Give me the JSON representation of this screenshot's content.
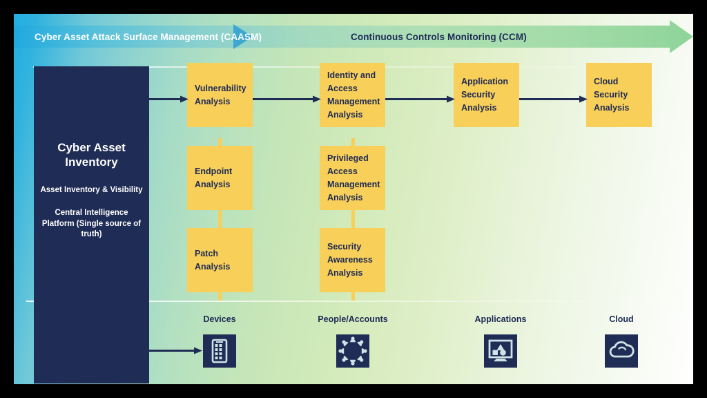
{
  "diagram": {
    "title": "Cyber Asset Attack Surface Management and Continuous Controls Monitoring",
    "colors": {
      "dark_navy": "#1F2C55",
      "accent_yellow": "#F8CF59",
      "gradient_start": "#22AEE3",
      "gradient_mid": "#B9E2BE",
      "gradient_end": "#FFFFFF",
      "text_light": "#FFFFFF"
    }
  },
  "banner": {
    "left_label": "Cyber Asset Attack Surface Management (CAASM)",
    "right_label": "Continuous Controls Monitoring (CCM)"
  },
  "inventory": {
    "title": "Cyber Asset Inventory",
    "line1": "Asset Inventory & Visibility",
    "line2": "Central Intelligence Platform\n(Single source of truth)",
    "line2_a": "Central Intelligence",
    "line2_b": "Platform",
    "line2_c": "(Single source of truth)"
  },
  "columns": [
    {
      "name": "devices",
      "boxes": [
        {
          "lines": [
            "Vulnerability",
            "Analysis"
          ]
        },
        {
          "lines": [
            "Endpoint",
            "Analysis"
          ]
        },
        {
          "lines": [
            "Patch",
            "Analysis"
          ]
        }
      ]
    },
    {
      "name": "people-accounts",
      "boxes": [
        {
          "lines": [
            "Identity and",
            "Access",
            "Management",
            "Analysis"
          ]
        },
        {
          "lines": [
            "Privileged",
            "Access",
            "Management",
            "Analysis"
          ]
        },
        {
          "lines": [
            "Security",
            "Awareness",
            "Analysis"
          ]
        }
      ]
    },
    {
      "name": "applications",
      "boxes": [
        {
          "lines": [
            "Application",
            "Security",
            "Analysis"
          ]
        }
      ]
    },
    {
      "name": "cloud",
      "boxes": [
        {
          "lines": [
            "Cloud",
            "Security",
            "Analysis"
          ]
        }
      ]
    }
  ],
  "categories": [
    {
      "label": "Devices",
      "icon": "server-device-icon"
    },
    {
      "label": "People/Accounts",
      "icon": "people-network-icon"
    },
    {
      "label": "Applications",
      "icon": "monitor-shapes-icon"
    },
    {
      "label": "Cloud",
      "icon": "cloud-icon"
    }
  ]
}
